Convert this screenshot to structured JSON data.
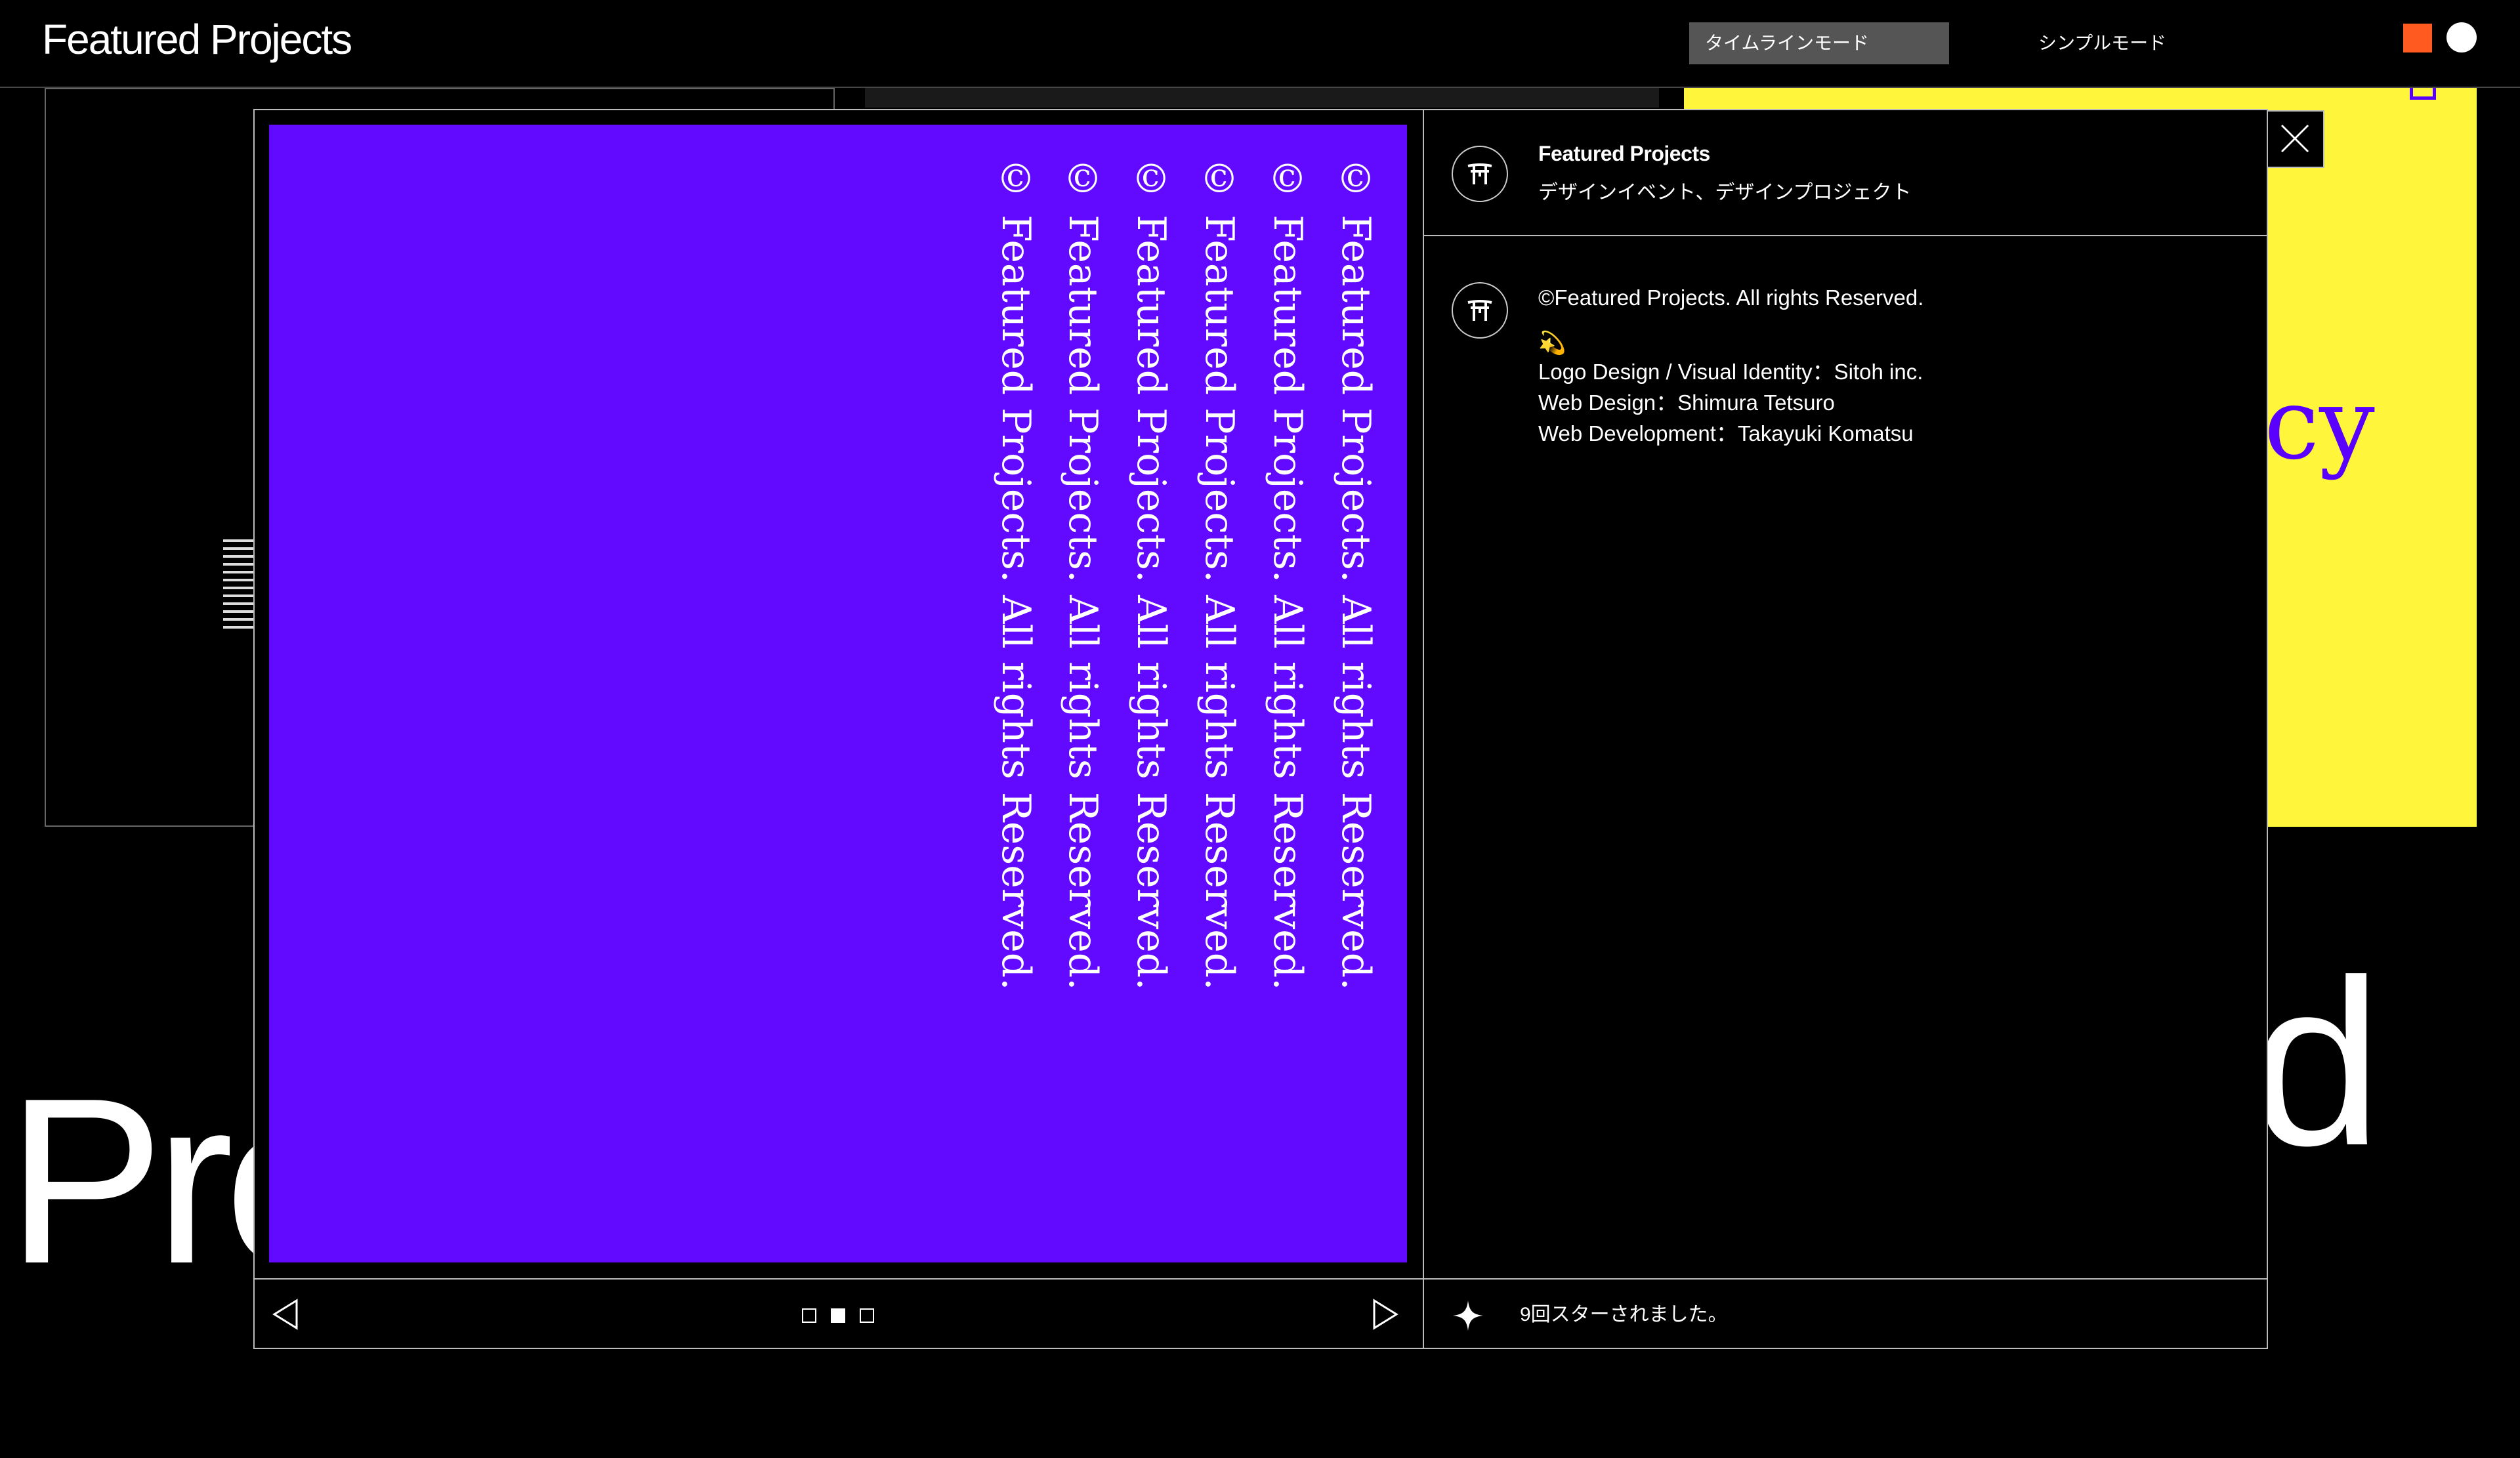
{
  "header": {
    "logo": "Featured Projects",
    "modes": [
      "タイムラインモード",
      "シンプルモード"
    ],
    "active_mode": 0,
    "swatches": {
      "orange": "#ff5a1f",
      "white": "#ffffff"
    }
  },
  "background": {
    "yellow_card_text": "cy",
    "large_text_left": "Pro",
    "large_text_right": "d",
    "colors": {
      "yellow": "#fff53a",
      "violet": "#5a00ff"
    }
  },
  "modal": {
    "slide": {
      "background": "#6209ff",
      "lines": [
        "© Featured Projects. All rights Reserved.",
        "© Featured Projects. All rights Reserved.",
        "© Featured Projects. All rights Reserved.",
        "© Featured Projects. All rights Reserved.",
        "© Featured Projects. All rights Reserved.",
        "© Featured Projects. All rights Reserved."
      ]
    },
    "author": {
      "name": "Featured Projects",
      "tagline": "デザインイベント、デザインプロジェクト",
      "avatar_icon": "torii-gate-icon"
    },
    "description": {
      "copyright": "©Featured Projects. All rights Reserved.",
      "emoji": "💫",
      "credits": [
        "Logo Design / Visual Identity：Sitoh inc.",
        "Web Design：Shimura Tetsuro",
        "Web Development：Takayuki Komatsu"
      ]
    },
    "pagination": {
      "total": 3,
      "current": 2
    },
    "stars": {
      "text": "9回スターされました。"
    }
  }
}
